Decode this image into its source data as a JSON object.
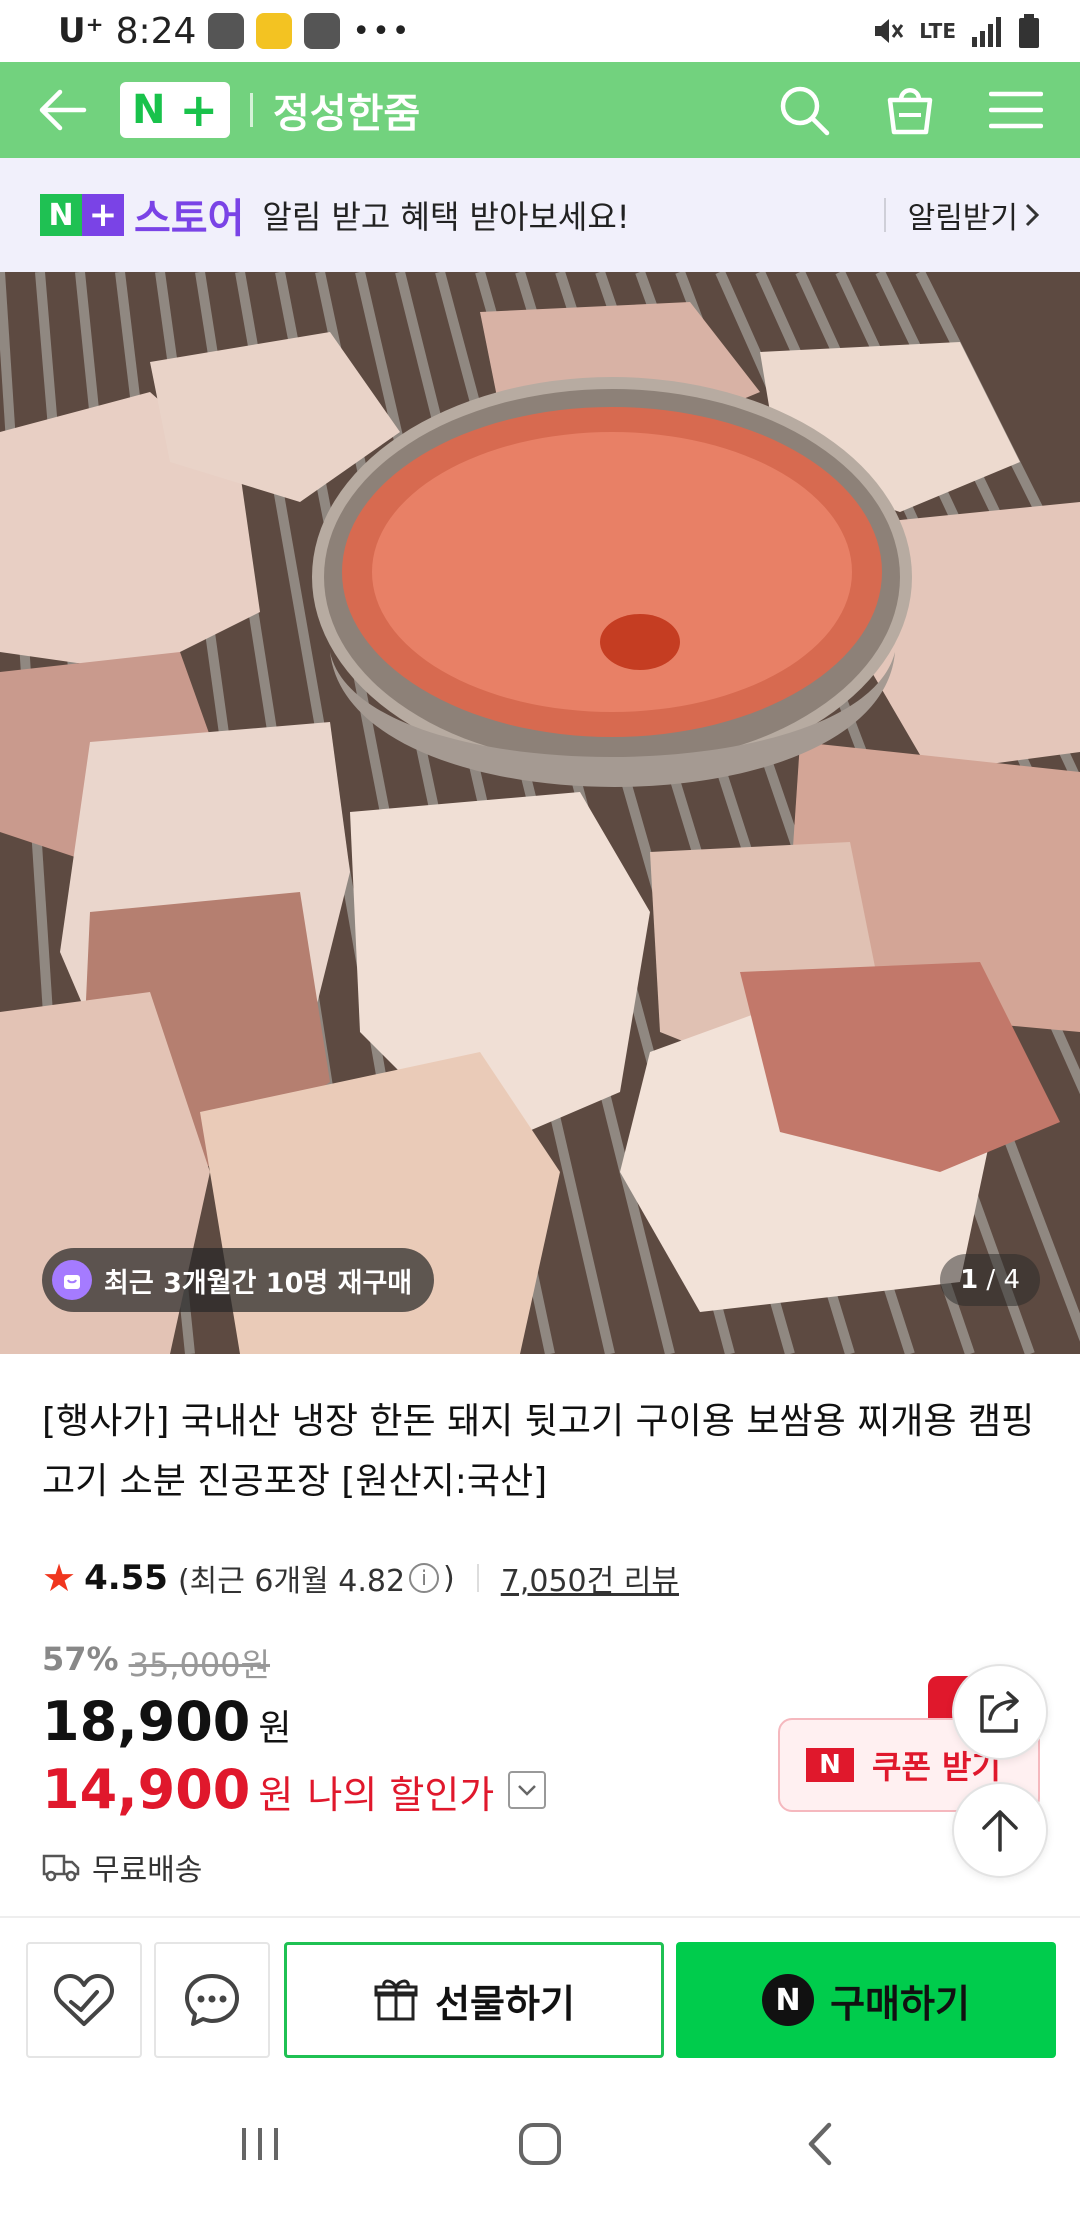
{
  "status_bar": {
    "carrier": "U⁺",
    "time": "8:24",
    "network": "LTE"
  },
  "header": {
    "logo_text": "N",
    "store_name": "정성한줌"
  },
  "banner": {
    "badge_text": "스토어",
    "message": "알림 받고 혜택 받아보세요!",
    "action_label": "알림받기"
  },
  "hero": {
    "repurchase_text": "최근 3개월간 10명 재구매",
    "page_current": "1",
    "page_total": "/ 4"
  },
  "product": {
    "title": "[행사가] 국내산 냉장 한돈 돼지 뒷고기 구이용 보쌈용 찌개용 캠핑고기 소분 진공포장 [원산지:국산]",
    "rating": "4.55",
    "rating_recent": "(최근 6개월 4.82",
    "rating_recent_close": ")",
    "review_count": "7,050건 리뷰",
    "discount_rate": "57%",
    "original_price": "35,000원",
    "price": "18,900",
    "price_unit": "원",
    "my_price": "14,900",
    "my_price_unit": "원",
    "my_price_label": "나의 할인가",
    "shipping": "무료배송",
    "coupon_label": "쿠폰 받기"
  },
  "actions": {
    "gift_label": "선물하기",
    "buy_label": "구매하기"
  },
  "colors": {
    "header_green": "#72d27e",
    "buy_green": "#00cc4c",
    "discount_red": "#e0182c",
    "store_purple": "#7a43e6"
  }
}
